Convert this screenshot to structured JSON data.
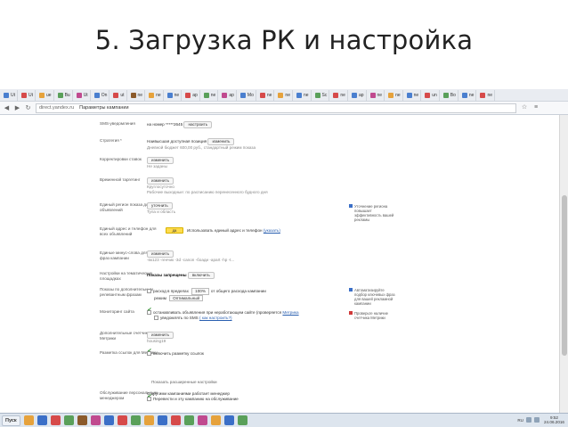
{
  "slide": {
    "title": "5. Загрузка РК и настройка"
  },
  "browser": {
    "bookmarks": [
      {
        "label": "Ut",
        "color": "#4a7fcf"
      },
      {
        "label": "Ut",
        "color": "#d64a4a"
      },
      {
        "label": "ue",
        "color": "#e6a23c"
      },
      {
        "label": "Bu",
        "color": "#5aa05a"
      },
      {
        "label": "Ut",
        "color": "#c04a8f"
      },
      {
        "label": "On",
        "color": "#4a7fcf"
      },
      {
        "label": "ut",
        "color": "#d64a4a"
      },
      {
        "label": "ne",
        "color": "#8b5a2b"
      },
      {
        "label": "ne",
        "color": "#e6a23c"
      },
      {
        "label": "ne",
        "color": "#4a7fcf"
      },
      {
        "label": "ap",
        "color": "#d64a4a"
      },
      {
        "label": "ne",
        "color": "#5aa05a"
      },
      {
        "label": "ap",
        "color": "#c04a8f"
      },
      {
        "label": "Mo",
        "color": "#4a7fcf"
      },
      {
        "label": "ne",
        "color": "#d64a4a"
      },
      {
        "label": "ne",
        "color": "#e6a23c"
      },
      {
        "label": "ne",
        "color": "#4a7fcf"
      },
      {
        "label": "Sc",
        "color": "#5aa05a"
      },
      {
        "label": "ne",
        "color": "#d64a4a"
      },
      {
        "label": "ap",
        "color": "#4a7fcf"
      },
      {
        "label": "ne",
        "color": "#c04a8f"
      },
      {
        "label": "ne",
        "color": "#e6a23c"
      },
      {
        "label": "ne",
        "color": "#4a7fcf"
      },
      {
        "label": "un",
        "color": "#d64a4a"
      },
      {
        "label": "Bo",
        "color": "#5aa05a"
      },
      {
        "label": "ne",
        "color": "#4a7fcf"
      },
      {
        "label": "ne",
        "color": "#d64a4a"
      }
    ],
    "url": "direct.yandex.ru",
    "tab_title": "Параметры кампании"
  },
  "form": {
    "rows": [
      {
        "label": "SMS-уведомления",
        "value": "на номер *****2645",
        "button": "настроить"
      },
      {
        "label": "Стратегия *",
        "value": "Наивысшая доступная позиция",
        "button": "изменить",
        "sub": "Дневной бюджет 600,00 руб., стандартный режим показа"
      },
      {
        "label": "Корректировки ставок",
        "button": "изменить",
        "sub": "Не заданы"
      },
      {
        "label": "Временной таргетинг",
        "button": "изменить",
        "sub": "Круглосуточно",
        "sub2": "Рабочие выходные: по расписанию перенесенного будного дня"
      },
      {
        "label": "Единый регион показа для всех объявлений",
        "button": "уточнить",
        "sub": "Тула и область"
      },
      {
        "label": "Единый адрес и телефон для всех объявлений",
        "toggle": "да",
        "value": "Использовать единый адрес и телефон",
        "link": "(указать)"
      },
      {
        "label": "Единые минус-слова для всех фраз кампании",
        "button": "изменить",
        "sub": "-вк123 -генчик -3d -canon -боади -apart -hp -t..."
      },
      {
        "label": "Настройки на тематических площадках",
        "bold": "Показы запрещены",
        "button": "включить"
      },
      {
        "label": "Показы по дополнительным релевантным фразам",
        "value": "расход в пределах",
        "select1": "100%",
        "value2": "от общего расхода кампании",
        "value3": "режим",
        "select2": "Оптимальный"
      },
      {
        "label": "Мониторинг сайта",
        "value": "останавливать объявления при неработающем сайте (проверяется",
        "link": "Метрика",
        "sub": "уведомлять по SMS",
        "sublink": "( как настроить?)"
      },
      {
        "label": "Дополнительные счетчики Метрики",
        "button": "изменить",
        "sub": "housing19"
      },
      {
        "label": "Разметка ссылок для Метрики",
        "value": "включить разметку ссылок"
      },
      {
        "label": "",
        "value": "Показать расширенные настройки"
      },
      {
        "label": "Обслуживание персональным менеджером",
        "value": "С другими кампаниями работает менеджер",
        "sub": "Перевести и эту кампанию на обслуживание"
      }
    ],
    "hints": [
      {
        "text": "Уточнение региона повышает эффективность вашей рекламы",
        "color": "#3b6fc7"
      },
      {
        "text": "Автоматизируйте подбор ключевых фраз для вашей рекламной кампании",
        "color": "#3b6fc7"
      },
      {
        "text": "Проверьте наличие счетчика Метрики",
        "color": "#d03a3a"
      }
    ]
  },
  "taskbar": {
    "start_label": "Пуск",
    "apps": [
      "#e6a23c",
      "#3b6fc7",
      "#d64a4a",
      "#5aa05a",
      "#8b5a2b",
      "#c04a8f",
      "#3b6fc7",
      "#d64a4a",
      "#5aa05a",
      "#e6a23c",
      "#3b6fc7",
      "#d64a4a",
      "#5aa05a",
      "#c04a8f",
      "#e6a23c",
      "#3b6fc7",
      "#5aa05a"
    ],
    "lang": "RU",
    "time": "9:52",
    "date": "24.06.2016"
  }
}
